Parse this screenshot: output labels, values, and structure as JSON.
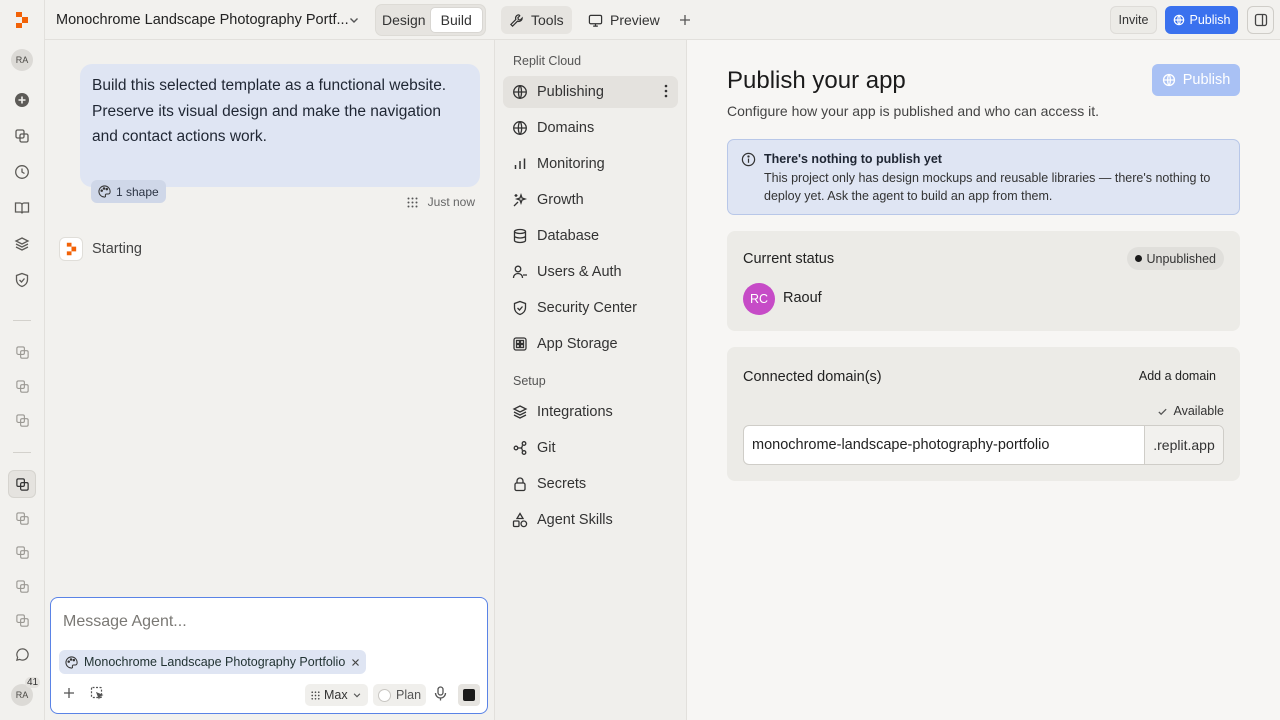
{
  "topbar": {
    "project_title": "Monochrome Landscape Photography Portf...",
    "mode_design": "Design",
    "mode_build": "Build",
    "tab_tools": "Tools",
    "tab_preview": "Preview",
    "invite": "Invite",
    "publish": "Publish"
  },
  "rail": {
    "avatar_initials": "RA",
    "bottom_avatar_initials": "RA",
    "notification_count": "41"
  },
  "chat": {
    "user_message": "Build this selected template as a functional website. Preserve its visual design and make the navigation and contact actions work.",
    "attachment_chip": "1 shape",
    "timestamp": "Just now",
    "agent_status": "Starting",
    "composer_placeholder": "Message Agent...",
    "context_chip": "Monochrome Landscape Photography Portfolio",
    "model_label": "Max",
    "plan_label": "Plan"
  },
  "tools_nav": {
    "section_cloud": "Replit Cloud",
    "cloud_items": [
      {
        "label": "Publishing",
        "icon": "publishing-icon"
      },
      {
        "label": "Domains",
        "icon": "globe-icon"
      },
      {
        "label": "Monitoring",
        "icon": "bar-chart-icon"
      },
      {
        "label": "Growth",
        "icon": "growth-icon"
      },
      {
        "label": "Database",
        "icon": "database-icon"
      },
      {
        "label": "Users & Auth",
        "icon": "users-icon"
      },
      {
        "label": "Security Center",
        "icon": "shield-icon"
      },
      {
        "label": "App Storage",
        "icon": "storage-icon"
      }
    ],
    "section_setup": "Setup",
    "setup_items": [
      {
        "label": "Integrations",
        "icon": "layers-icon"
      },
      {
        "label": "Git",
        "icon": "git-icon"
      },
      {
        "label": "Secrets",
        "icon": "lock-icon"
      },
      {
        "label": "Agent Skills",
        "icon": "shapes-icon"
      }
    ]
  },
  "main": {
    "title": "Publish your app",
    "subtitle": "Configure how your app is published and who can access it.",
    "publish_button": "Publish",
    "notice": {
      "title": "There's nothing to publish yet",
      "body": "This project only has design mockups and reusable libraries — there's nothing to deploy yet. Ask the agent to build an app from them."
    },
    "status_card": {
      "title": "Current status",
      "badge": "Unpublished",
      "user_initials": "RC",
      "user_name": "Raouf"
    },
    "domain_card": {
      "title": "Connected domain(s)",
      "add_domain": "Add a domain",
      "availability": "Available",
      "domain_value": "monochrome-landscape-photography-portfolio",
      "domain_suffix": ".replit.app"
    }
  },
  "colors": {
    "accent": "#3a71ee",
    "accent_disabled": "#a9c1f4",
    "replit_orange": "#f26207",
    "avatar_magenta": "#c64bc7"
  }
}
